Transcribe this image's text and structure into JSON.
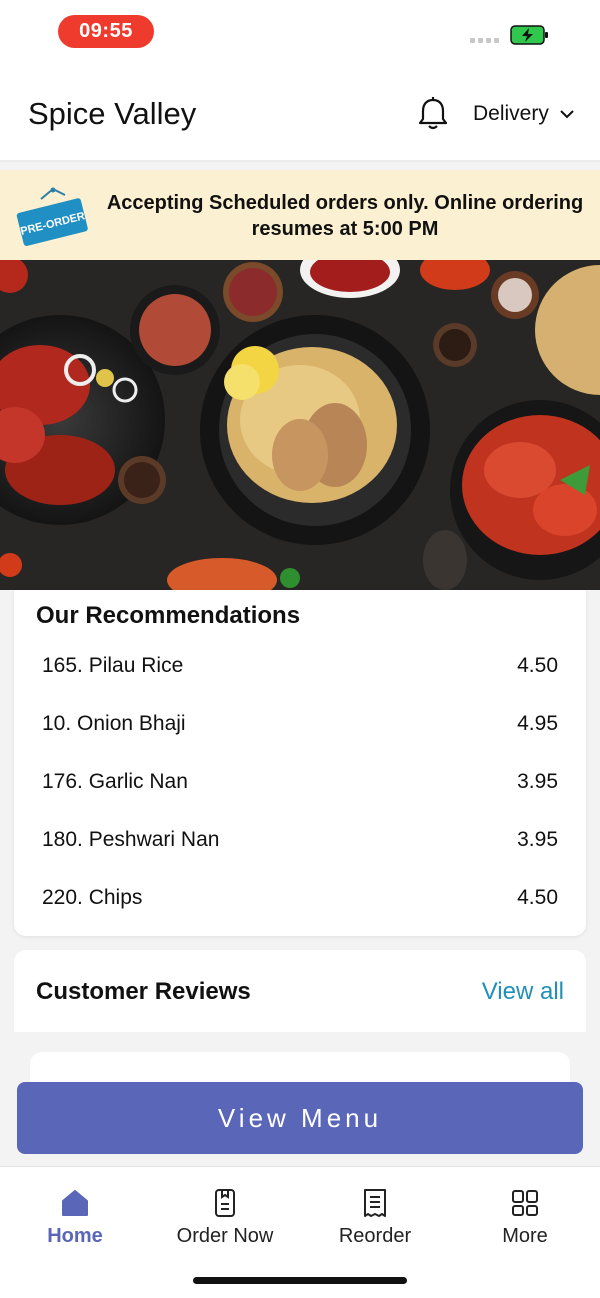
{
  "status_bar": {
    "time": "09:55"
  },
  "header": {
    "title": "Spice Valley",
    "mode": "Delivery"
  },
  "banner": {
    "badge": "PRE-ORDER",
    "message": "Accepting Scheduled orders only. Online ordering resumes at 5:00 PM"
  },
  "recommendations": {
    "title": "Our Recommendations",
    "items": [
      {
        "name": "165. Pilau Rice",
        "price": "4.50"
      },
      {
        "name": "10. Onion Bhaji",
        "price": "4.95"
      },
      {
        "name": "176. Garlic Nan",
        "price": "3.95"
      },
      {
        "name": "180. Peshwari Nan",
        "price": "3.95"
      },
      {
        "name": "220. Chips",
        "price": "4.50"
      }
    ]
  },
  "reviews": {
    "title": "Customer Reviews",
    "view_all": "View all"
  },
  "cta": {
    "label": "View Menu"
  },
  "tabs": [
    {
      "label": "Home",
      "icon": "home-icon"
    },
    {
      "label": "Order Now",
      "icon": "order-icon"
    },
    {
      "label": "Reorder",
      "icon": "receipt-icon"
    },
    {
      "label": "More",
      "icon": "grid-icon"
    }
  ],
  "colors": {
    "accent": "#5a66b8",
    "link": "#1f8fb8",
    "banner_bg": "#fbf1d2",
    "time_pill": "#ef3b2d"
  }
}
